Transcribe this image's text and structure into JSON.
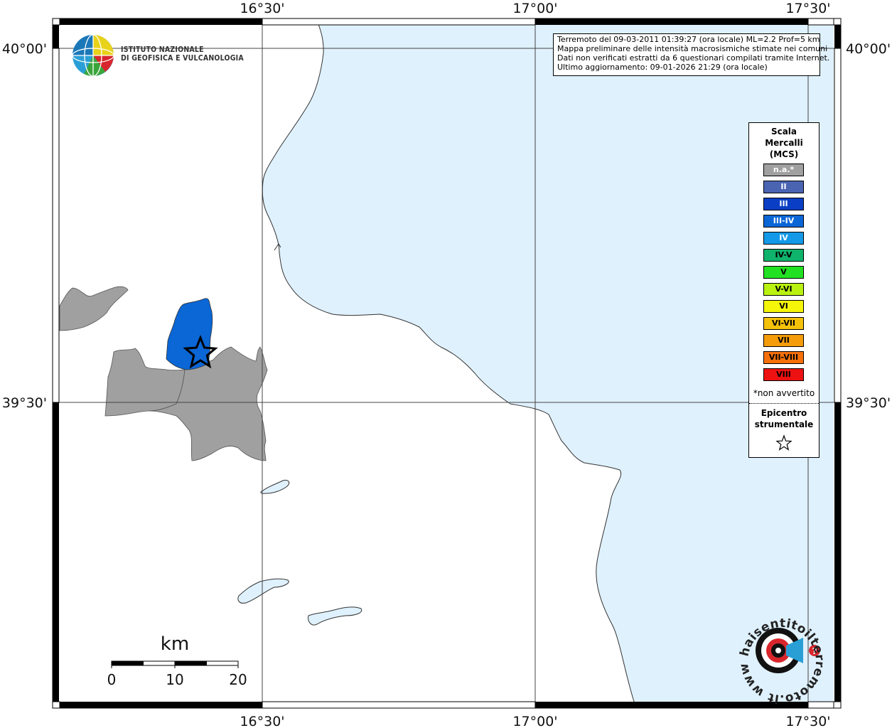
{
  "map": {
    "top_ticks": [
      "16°30'",
      "17°00'",
      "17°30'"
    ],
    "bottom_ticks": [
      "16°30'",
      "17°00'",
      "17°30'"
    ],
    "left_ticks": [
      "40°00'",
      "39°30'"
    ],
    "right_ticks": [
      "40°00'",
      "39°30'"
    ],
    "colors": {
      "sea": "#dff1fd",
      "land": "#ffffff",
      "na_area": "#a0a0a0",
      "intensity_III_IV": "#0b66d6"
    }
  },
  "institute": {
    "line1": "ISTITUTO NAZIONALE",
    "line2": "DI GEOFISICA E VULCANOLOGIA"
  },
  "info": {
    "line1": "Terremoto del 09-03-2011 01:39:27 (ora locale) ML=2.2 Prof=5 km",
    "line2": "Mappa preliminare delle intensità macrosismiche stimate nei comuni",
    "line3": "Dati non verificati estratti da 6 questionari compilati tramite Internet.",
    "line4": "Ultimo aggiornamento: 09-01-2026 21:29 (ora locale)"
  },
  "legend": {
    "title1": "Scala",
    "title2": "Mercalli",
    "title3": "(MCS)",
    "items": [
      {
        "label": "n.a.*",
        "color": "#a0a0a0"
      },
      {
        "label": "II",
        "color": "#4a64b2"
      },
      {
        "label": "III",
        "color": "#0a3fc5"
      },
      {
        "label": "III-IV",
        "color": "#0b66d6"
      },
      {
        "label": "IV",
        "color": "#1399e8"
      },
      {
        "label": "IV-V",
        "color": "#0fb36b"
      },
      {
        "label": "V",
        "color": "#22e022"
      },
      {
        "label": "V-VI",
        "color": "#b9f20f"
      },
      {
        "label": "VI",
        "color": "#f5f50a"
      },
      {
        "label": "VI-VII",
        "color": "#f5c20a"
      },
      {
        "label": "VII",
        "color": "#f59c0a"
      },
      {
        "label": "VII-VIII",
        "color": "#f5700a"
      },
      {
        "label": "VIII",
        "color": "#ee1111"
      }
    ],
    "note": "*non avvertito",
    "epicenter1": "Epicentro",
    "epicenter2": "strumentale"
  },
  "scale_bar": {
    "unit": "km",
    "labels": [
      "0",
      "10",
      "20"
    ]
  },
  "site_logo": {
    "text": "haisentitoilterremoto.it www."
  }
}
